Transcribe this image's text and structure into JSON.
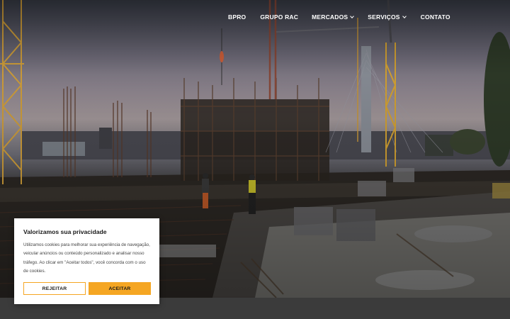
{
  "nav": {
    "items": [
      {
        "label": "BPRO",
        "has_dropdown": false
      },
      {
        "label": "GRUPO RAC",
        "has_dropdown": false
      },
      {
        "label": "MERCADOS",
        "has_dropdown": true
      },
      {
        "label": "SERVIÇOS",
        "has_dropdown": true
      },
      {
        "label": "CONTATO",
        "has_dropdown": false
      }
    ]
  },
  "cookie_banner": {
    "title": "Valorizamos sua privacidade",
    "text": "Utilizamos cookies para melhorar sua experiência de navegação, veicular anúncios ou conteúdo personalizado e analisar nosso tráfego. Ao clicar em \"Aceitar todos\", você concorda com o uso de cookies.",
    "reject_label": "REJEITAR",
    "accept_label": "ACEITAR"
  },
  "colors": {
    "accent": "#f5a623",
    "nav_text": "#ffffff",
    "bottom_band": "#3b3b3b"
  }
}
